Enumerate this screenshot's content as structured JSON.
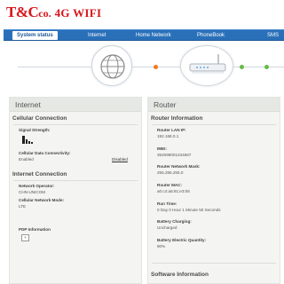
{
  "header": {
    "logo_big": "T&C",
    "logo_small": "co.",
    "logo_wifi": "4G WIFI",
    "brand_color": "#d8151b"
  },
  "nav": {
    "items": [
      {
        "label": "System status",
        "active": true
      },
      {
        "label": "Internet"
      },
      {
        "label": "Home Network"
      },
      {
        "label": "PhoneBook"
      },
      {
        "label": "SMS"
      }
    ],
    "color": "#2a70b9"
  },
  "diagram": {
    "globe_icon": "globe-icon",
    "router_icon": "router-icon",
    "dot_colors": [
      "#f07a1a",
      "#66bb44",
      "#66bb44"
    ]
  },
  "internet": {
    "title": "Internet",
    "cellular_title": "Cellular Connection",
    "signal_label": "Signal Strength:",
    "data_label": "Cellular Data Connectivity:",
    "data_value": "Enabled",
    "data_link": "Disabled",
    "connection_title": "Internet Connection",
    "operator_label": "Network Operator:",
    "operator_value": "CHN-UNICOM",
    "mode_label": "Cellular Network Mode:",
    "mode_value": "LTE",
    "pdp_label": "PDP Information",
    "pdp_button": "+"
  },
  "router": {
    "title": "Router",
    "info_title": "Router Information",
    "lan_ip_label": "Router LAN IP:",
    "lan_ip_value": "192.168.0.1",
    "imei_label": "IMEI:",
    "imei_value": "352099001234567",
    "mask_label": "Router Network Mask:",
    "mask_value": "255.255.255.0",
    "mac_label": "Router MAC:",
    "mac_value": "a0:c4:a6:91:e3:06",
    "run_label": "Run Time:",
    "run_value": "0 Day 0 Hour 1 Minute 50 Seconds",
    "charging_label": "Battery Charging:",
    "charging_value": "Uncharged",
    "quantity_label": "Battery Electric Quantity:",
    "quantity_value": "90%",
    "software_title": "Software Information"
  }
}
